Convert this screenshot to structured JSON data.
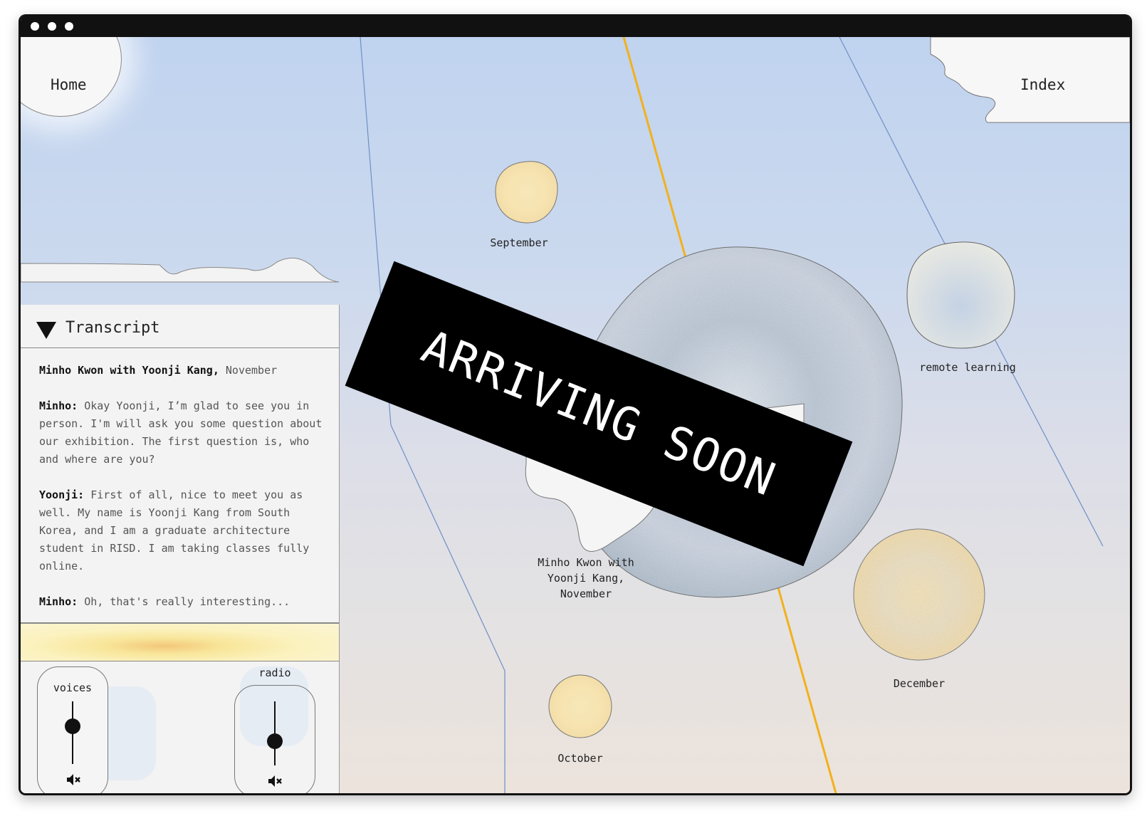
{
  "nav": {
    "home": "Home",
    "index": "Index"
  },
  "transcript": {
    "heading": "Transcript",
    "title_bold": "Minho Kwon with Yoonji Kang,",
    "title_month": "November",
    "lines": [
      {
        "speaker": "Minho:",
        "text": "Okay Yoonji, I’m glad to see you in person. I'm will ask you some question about our exhibition. The first question is, who and where are you?"
      },
      {
        "speaker": "Yoonji:",
        "text": "First of all, nice to meet you as well. My name is Yoonji Kang from South Korea, and I am a graduate architecture student in RISD. I am taking classes fully online."
      },
      {
        "speaker": "Minho:",
        "text": "Oh, that's really interesting..."
      }
    ]
  },
  "controls": {
    "voices": {
      "label": "voices",
      "level": 0.4,
      "muted": true
    },
    "radio": {
      "label": "radio",
      "level": 0.62,
      "muted": true
    }
  },
  "nodes": {
    "september": "September",
    "remote": "remote learning",
    "interview": "Minho Kwon with Yoonji Kang, November",
    "december": "December",
    "october": "October"
  },
  "banner": "ARRIVING SOON",
  "icons": {
    "mute": "speaker-muted-icon",
    "collapse": "triangle-down-icon"
  },
  "colors": {
    "accent_line": "#f2b11c",
    "thin_line": "#6f8fc6",
    "banner": "#000000"
  }
}
